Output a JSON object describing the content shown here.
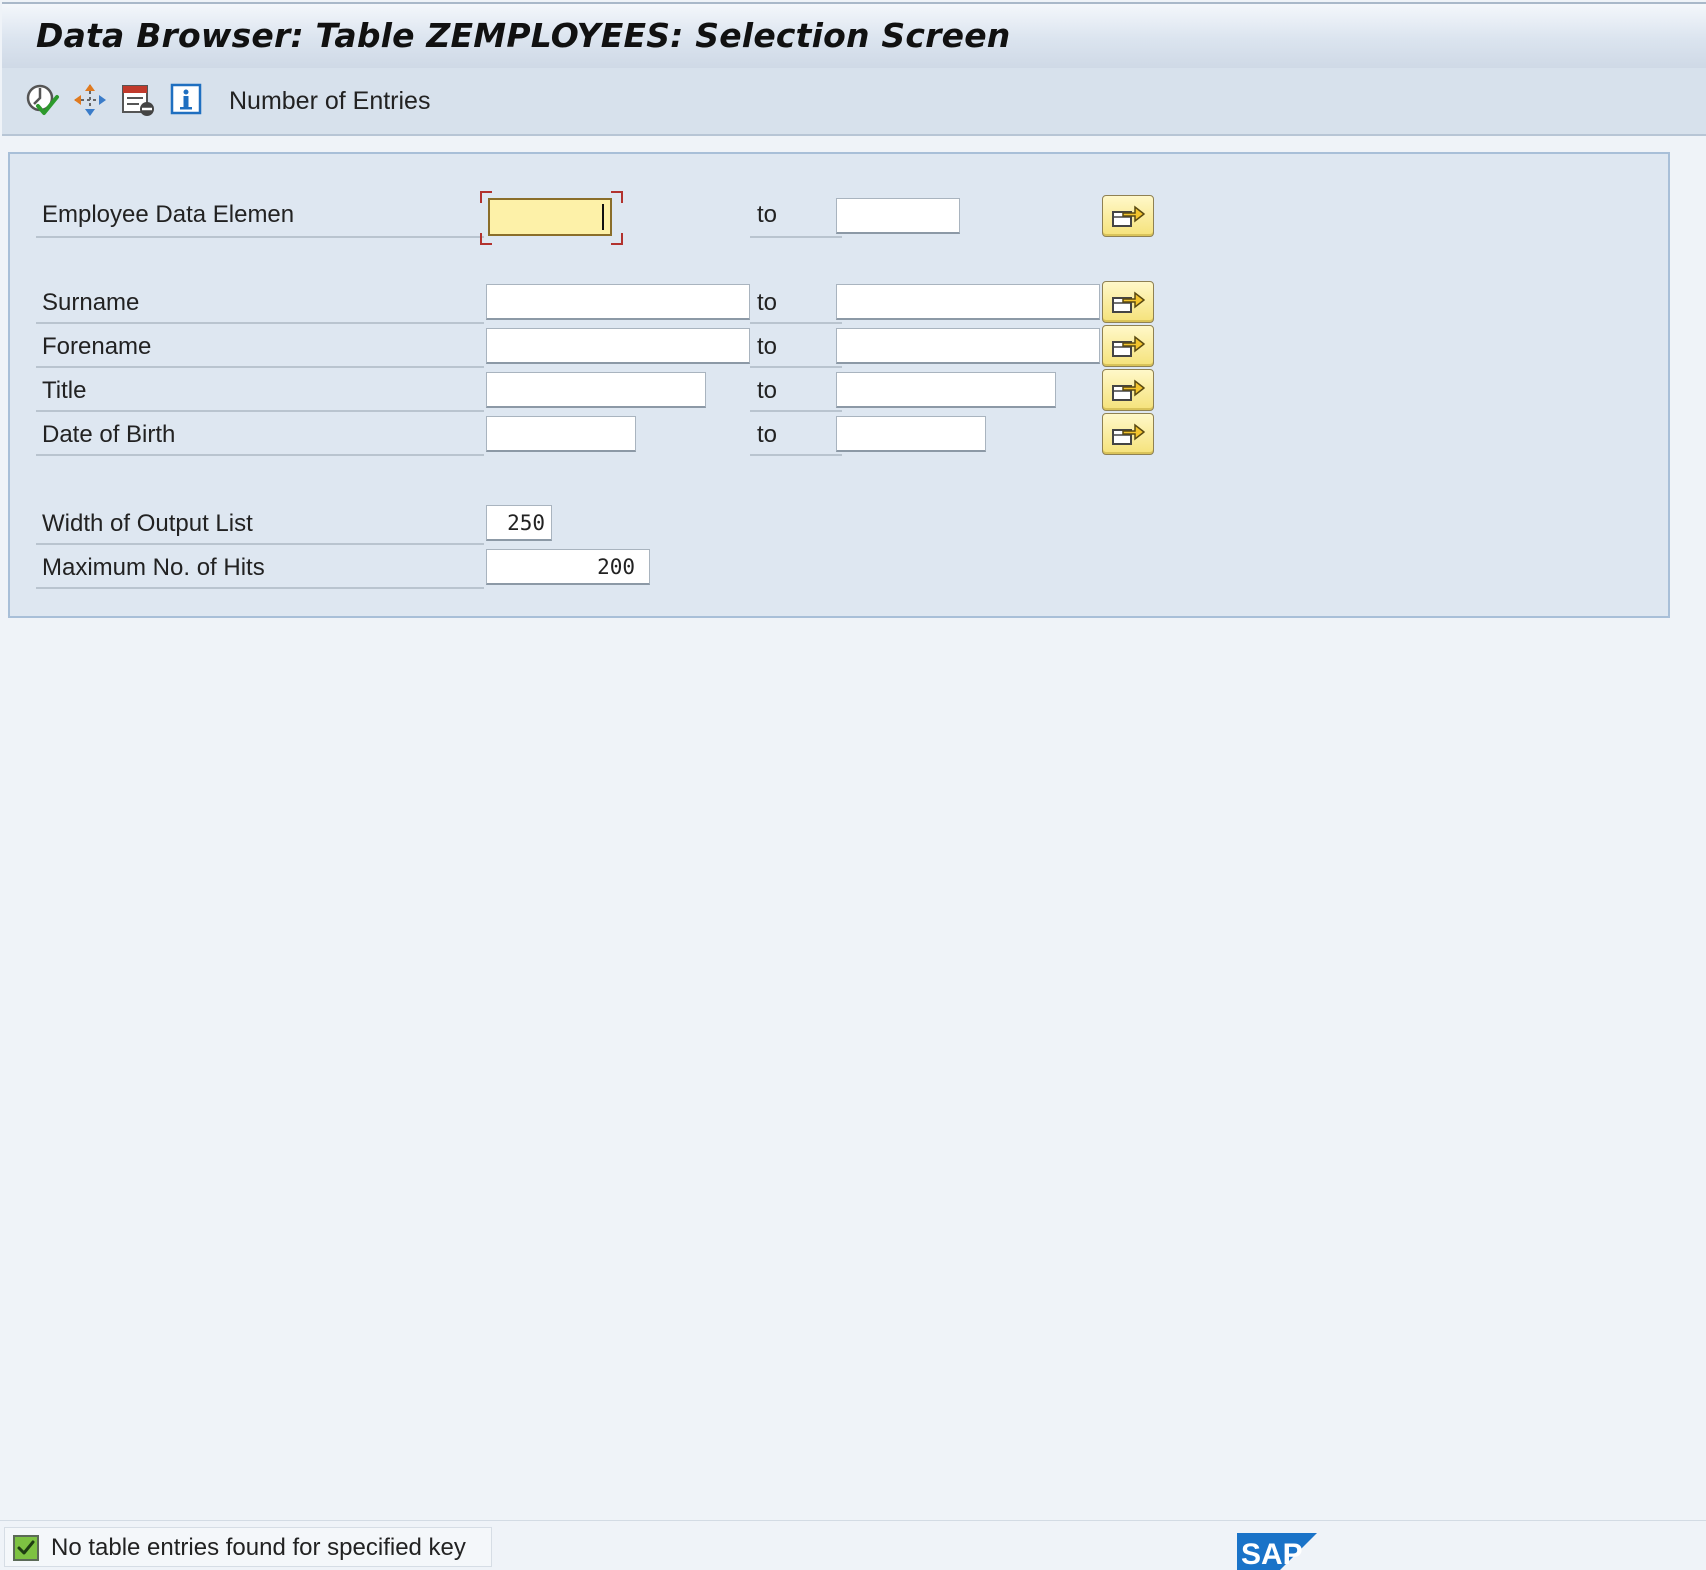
{
  "window": {
    "title": "Data Browser: Table ZEMPLOYEES: Selection Screen"
  },
  "toolbar": {
    "icons": [
      "execute-icon",
      "execute-in-background-icon",
      "delete-selection-icon",
      "information-icon"
    ],
    "number_of_entries_label": "Number of Entries"
  },
  "selection": {
    "to_label": "to",
    "employee_data_element": {
      "label": "Employee Data Elemen",
      "from": "",
      "to": ""
    },
    "surname": {
      "label": "Surname",
      "from": "",
      "to": ""
    },
    "forename": {
      "label": "Forename",
      "from": "",
      "to": ""
    },
    "title": {
      "label": "Title",
      "from": "",
      "to": ""
    },
    "date_of_birth": {
      "label": "Date of Birth",
      "from": "",
      "to": ""
    },
    "width_of_output_list": {
      "label": "Width of Output List",
      "value": "250"
    },
    "maximum_no_of_hits": {
      "label": "Maximum No. of Hits",
      "value": "200"
    }
  },
  "status": {
    "message": "No table entries found for specified key",
    "type_icon": "success-check-icon"
  },
  "branding": {
    "logo": "SAP"
  },
  "colors": {
    "focused_field": "#fdf1a8",
    "multi_select_button": "#f5e27a",
    "group_background": "#dee7f1",
    "sap_blue": "#1a73c8"
  }
}
